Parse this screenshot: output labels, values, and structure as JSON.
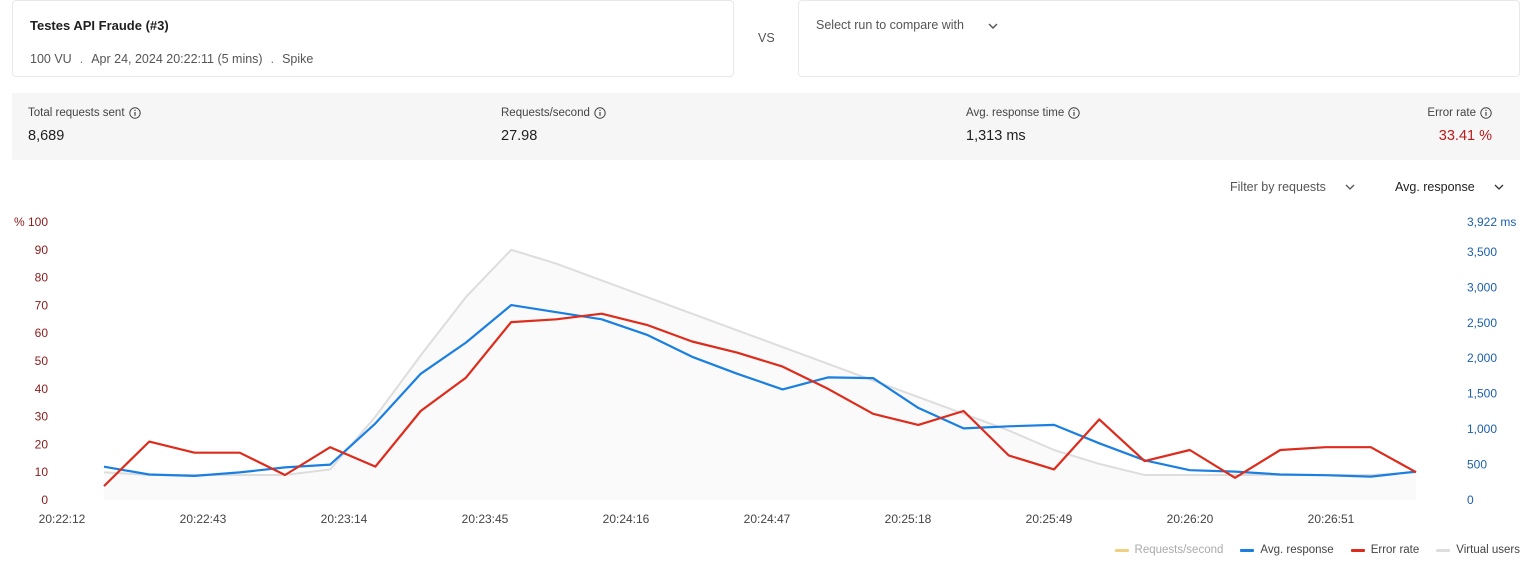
{
  "run": {
    "title": "Testes API Fraude  (#3)",
    "vus": "100 VU",
    "date": "Apr 24, 2024 20:22:11 (5 mins)",
    "scenario": "Spike",
    "separator": "."
  },
  "vs_label": "VS",
  "compare": {
    "placeholder": "Select run to compare with",
    "icon": "chevron-down-icon"
  },
  "stats": {
    "total_requests": {
      "label": "Total requests sent",
      "value": "8,689",
      "icon": "info-icon"
    },
    "requests_per_second": {
      "label": "Requests/second",
      "value": "27.98",
      "icon": "info-icon"
    },
    "avg_response_time": {
      "label": "Avg. response time",
      "value": "1,313 ms",
      "icon": "info-icon"
    },
    "error_rate": {
      "label": "Error rate",
      "value": "33.41 %",
      "icon": "info-icon"
    }
  },
  "filters": {
    "filter_by_requests": "Filter by requests",
    "metric": "Avg. response"
  },
  "colors": {
    "error_rate": "#dd2b1c",
    "avg_response": "#1a7fe0",
    "virtual_users": "#dddddd",
    "requests_per_second": "#f0d080",
    "left_axis": "#8b1a1a",
    "right_axis": "#1d5fae"
  },
  "chart_data": {
    "type": "line",
    "x_ticks": [
      "20:22:12",
      "20:22:43",
      "20:23:14",
      "20:23:45",
      "20:24:16",
      "20:24:47",
      "20:25:18",
      "20:25:49",
      "20:26:20",
      "20:26:51"
    ],
    "left_axis": {
      "ticks": [
        "0",
        "10",
        "20",
        "30",
        "40",
        "50",
        "60",
        "70",
        "80",
        "90"
      ],
      "top_label": "% 100",
      "range": [
        0,
        100
      ]
    },
    "right_axis": {
      "ticks": [
        "0",
        "500",
        "1,000",
        "1,500",
        "2,000",
        "2,500",
        "3,000",
        "3,500"
      ],
      "top_label": "3,922 ms",
      "range": [
        0,
        3922
      ]
    },
    "series": [
      {
        "name": "Virtual users",
        "axis": "left",
        "values": [
          10,
          9,
          9,
          9,
          9,
          11,
          30,
          52,
          73,
          90,
          85,
          79,
          73,
          67,
          61,
          55,
          49,
          43,
          37,
          31,
          25,
          18,
          13,
          9,
          9,
          9,
          9,
          9,
          9,
          10
        ]
      },
      {
        "name": "Avg. response",
        "axis": "right",
        "values": [
          470,
          360,
          340,
          390,
          460,
          500,
          1080,
          1780,
          2220,
          2750,
          2650,
          2550,
          2330,
          2020,
          1780,
          1560,
          1730,
          1720,
          1300,
          1010,
          1040,
          1060,
          800,
          560,
          420,
          400,
          360,
          350,
          330,
          400
        ]
      },
      {
        "name": "Error rate",
        "axis": "left",
        "values": [
          5,
          21,
          17,
          17,
          9,
          19,
          12,
          32,
          44,
          64,
          65,
          67,
          63,
          57,
          53,
          48,
          40,
          31,
          27,
          32,
          16,
          11,
          29,
          14,
          18,
          8,
          18,
          19,
          19,
          10
        ]
      }
    ],
    "legend": [
      {
        "name": "Requests/second",
        "enabled": false
      },
      {
        "name": "Avg. response",
        "enabled": true
      },
      {
        "name": "Error rate",
        "enabled": true
      },
      {
        "name": "Virtual users",
        "enabled": true
      }
    ],
    "legend_position": "bottom-right",
    "grid": false
  }
}
